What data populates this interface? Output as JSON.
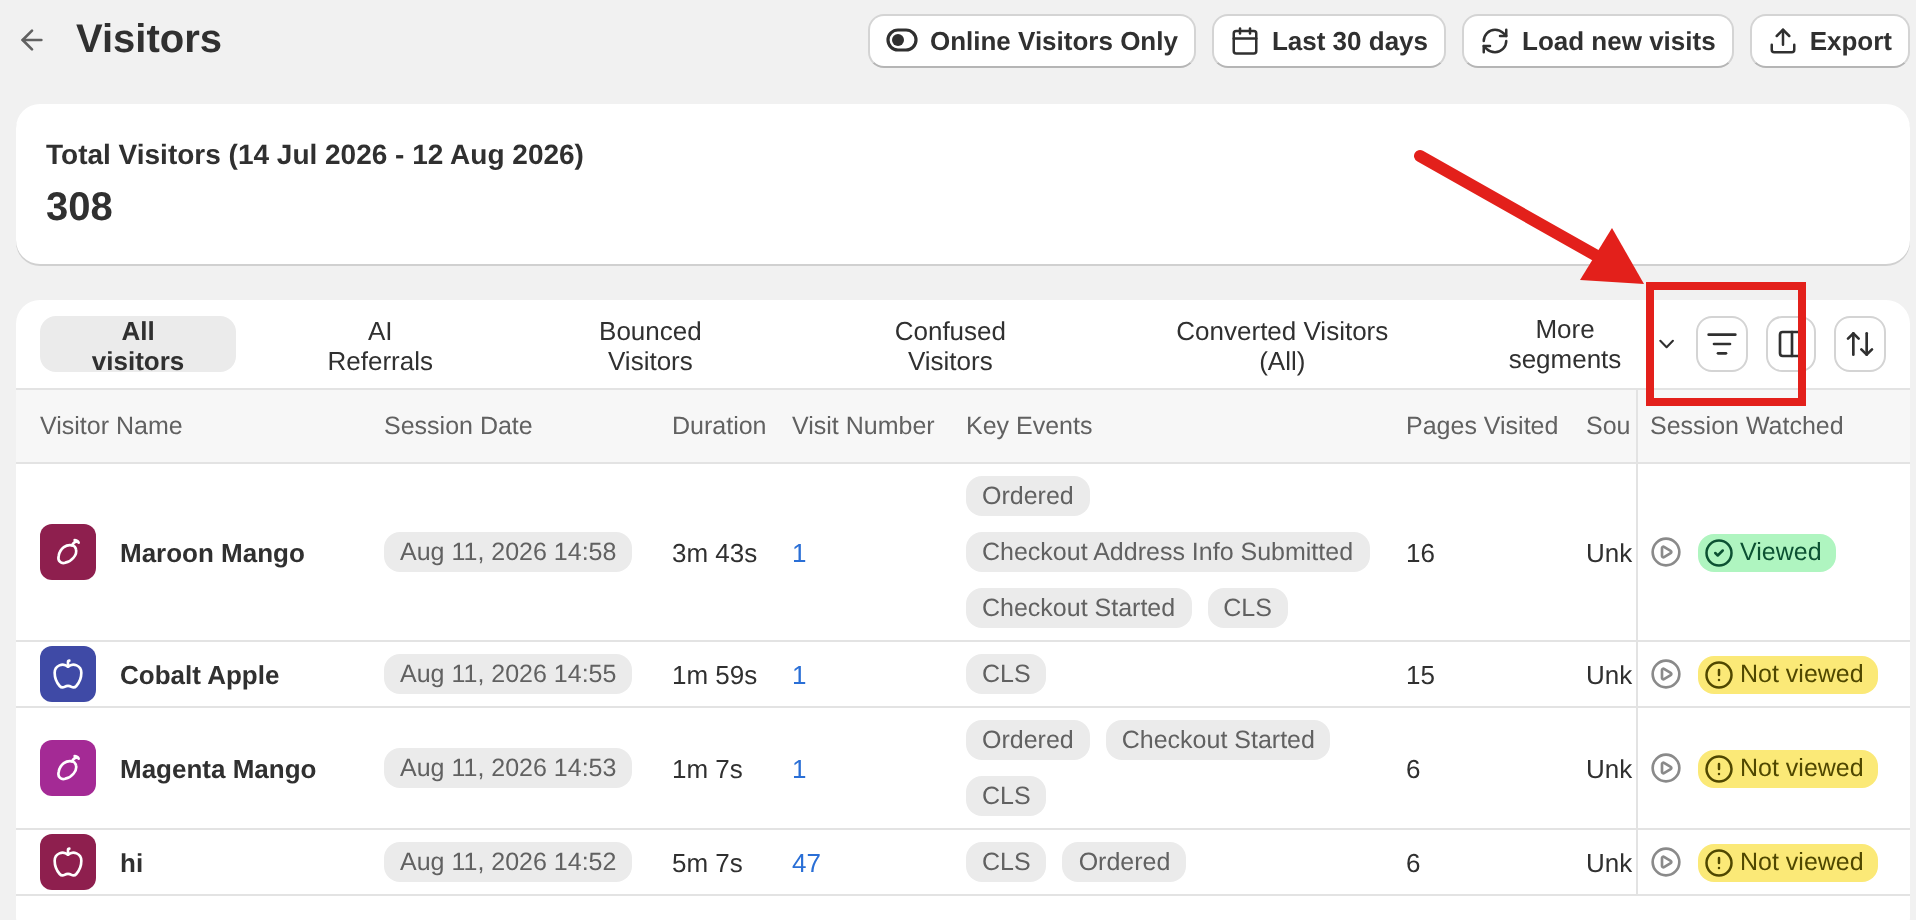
{
  "page": {
    "title": "Visitors"
  },
  "header_buttons": [
    {
      "kind": "toggle",
      "label": "Online Visitors Only"
    },
    {
      "kind": "calendar",
      "label": "Last 30 days"
    },
    {
      "kind": "refresh",
      "label": "Load new visits"
    },
    {
      "kind": "export",
      "label": "Export"
    }
  ],
  "summary": {
    "label": "Total Visitors (14 Jul 2026 - 12 Aug 2026)",
    "value": "308"
  },
  "segments": [
    {
      "label": "All visitors",
      "selected": true
    },
    {
      "label": "AI Referrals",
      "selected": false
    },
    {
      "label": "Bounced Visitors",
      "selected": false
    },
    {
      "label": "Confused Visitors",
      "selected": false
    },
    {
      "label": "Converted Visitors (All)",
      "selected": false
    }
  ],
  "more_segments": "More segments",
  "table": {
    "columns": [
      "Visitor Name",
      "Session Date",
      "Duration",
      "Visit Number",
      "Key Events",
      "Pages Visited",
      "Sou",
      "Session Watched"
    ],
    "rows": [
      {
        "name": "Maroon Mango",
        "kind": "mango",
        "color": "#8e1f4e",
        "date": "Aug 11, 2026 14:58",
        "duration": "3m 43s",
        "visit": "1",
        "events": [
          "Ordered",
          "Checkout Address Info Submitted",
          "Checkout Started",
          "CLS"
        ],
        "pages": "16",
        "source": "Unk",
        "viewed": true,
        "status": "Viewed"
      },
      {
        "name": "Cobalt Apple",
        "kind": "apple",
        "color": "#3f4aa6",
        "date": "Aug 11, 2026 14:55",
        "duration": "1m 59s",
        "visit": "1",
        "events": [
          "CLS"
        ],
        "pages": "15",
        "source": "Unk",
        "viewed": false,
        "status": "Not viewed"
      },
      {
        "name": "Magenta Mango",
        "kind": "mango",
        "color": "#a42a95",
        "date": "Aug 11, 2026 14:53",
        "duration": "1m 7s",
        "visit": "1",
        "events": [
          "Ordered",
          "Checkout Started",
          "CLS"
        ],
        "pages": "6",
        "source": "Unk",
        "viewed": false,
        "status": "Not viewed"
      },
      {
        "name": "hi",
        "kind": "apple",
        "color": "#8e1f4e",
        "date": "Aug 11, 2026 14:52",
        "duration": "5m 7s",
        "visit": "47",
        "events": [
          "CLS",
          "Ordered"
        ],
        "pages": "6",
        "source": "Unk",
        "viewed": false,
        "status": "Not viewed"
      }
    ]
  }
}
